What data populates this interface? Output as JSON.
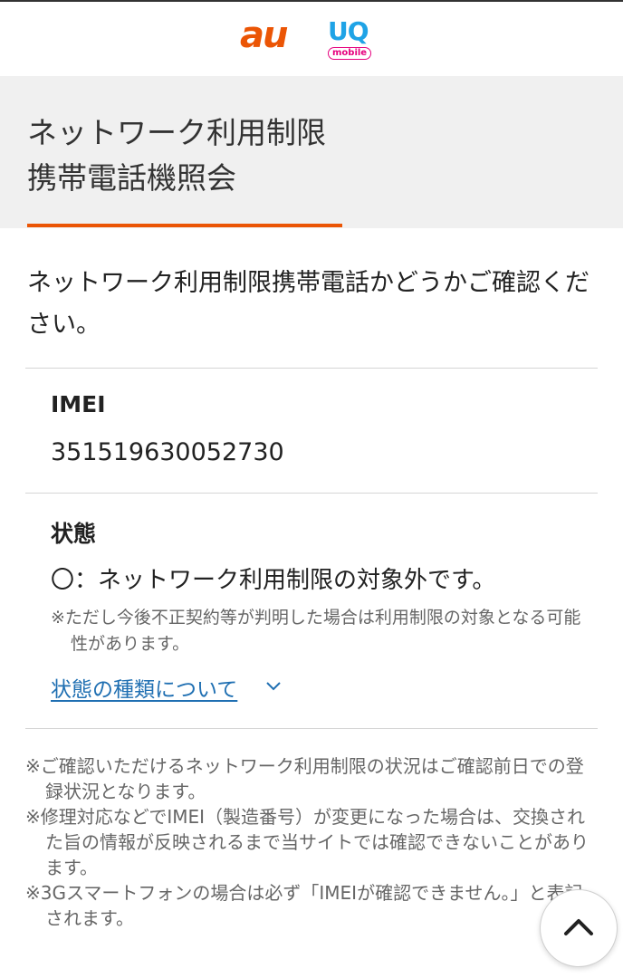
{
  "header": {
    "brand_au": "au",
    "brand_uq": "UQ",
    "brand_uq_sub": "mobile"
  },
  "page": {
    "title_line1": "ネットワーク利用制限",
    "title_line2": "携帯電話機照会"
  },
  "intro": "ネットワーク利用制限携帯電話かどうかご確認ください。",
  "imei": {
    "label": "IMEI",
    "value": "351519630052730"
  },
  "status": {
    "label": "状態",
    "result": "〇：ネットワーク利用制限の対象外です。",
    "note": "※ただし今後不正契約等が判明した場合は利用制限の対象となる可能性があります。",
    "link_label": "状態の種類について"
  },
  "notes": [
    "※ご確認いただけるネットワーク利用制限の状況はご確認前日での登録状況となります。",
    "※修理対応などでIMEI（製造番号）が変更になった場合は、交換された旨の情報が反映されるまで当サイトでは確認できないことがあります。",
    "※3Gスマートフォンの場合は必ず「IMEIが確認できません。」と表記されます。"
  ],
  "colors": {
    "accent": "#eb5505",
    "link": "#1f6fb2",
    "band": "#f0f0f0"
  },
  "icons": {
    "expand": "chevron-down-icon",
    "back_to_top": "chevron-up-icon"
  }
}
